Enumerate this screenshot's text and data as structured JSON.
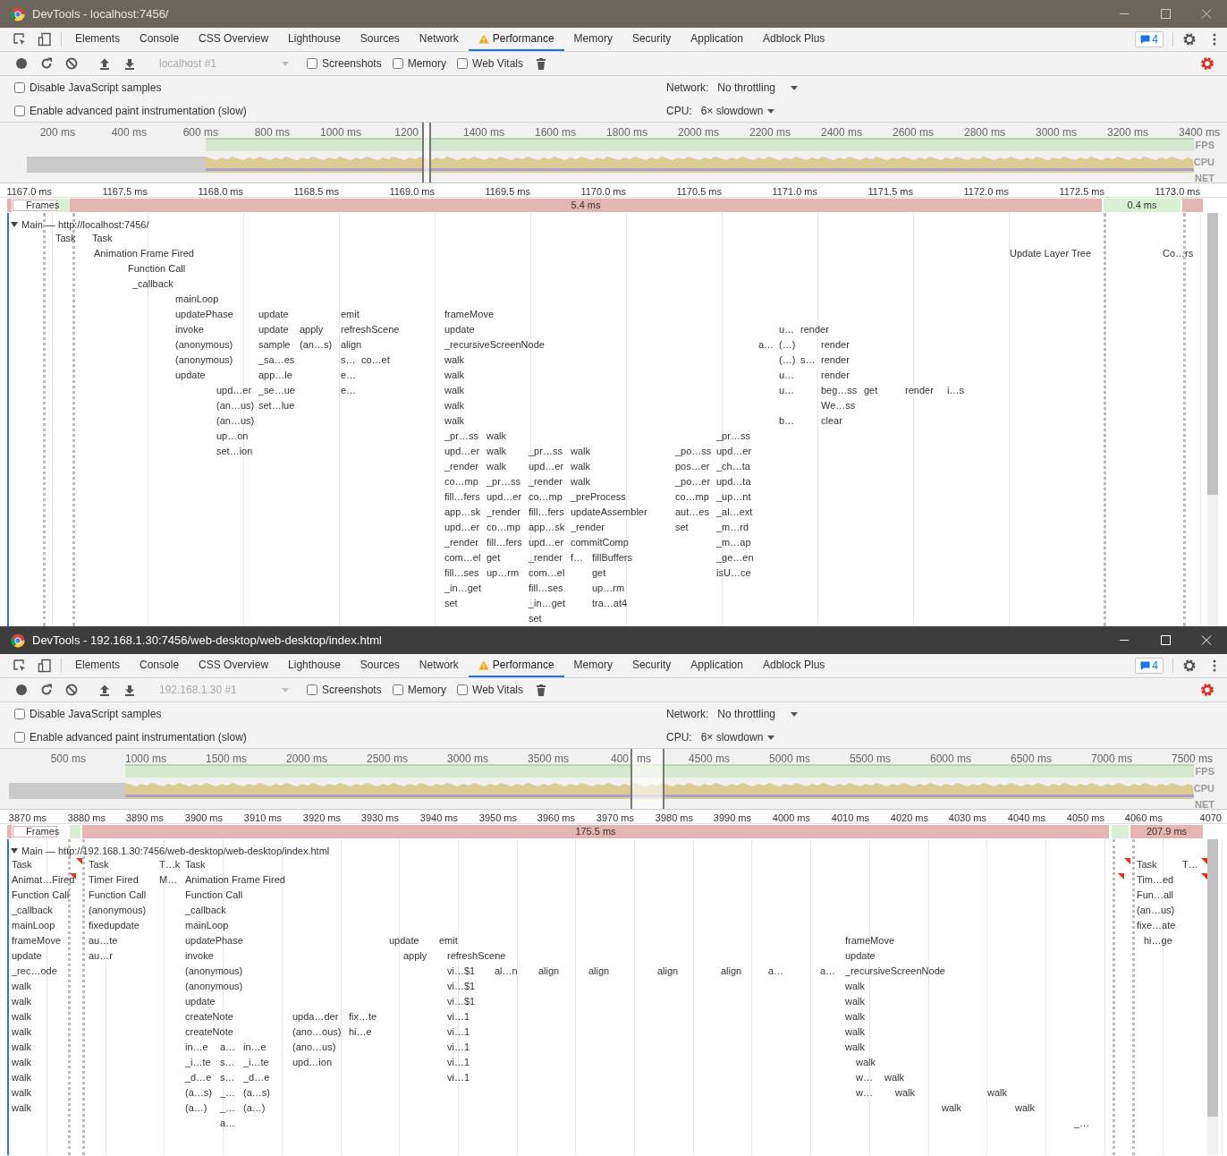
{
  "windows": [
    {
      "title": "DevTools - localhost:7456/",
      "active": false,
      "tabs": [
        {
          "label": "Elements",
          "selected": false,
          "warning": false
        },
        {
          "label": "Console",
          "selected": false,
          "warning": false
        },
        {
          "label": "CSS Overview",
          "selected": false,
          "warning": false
        },
        {
          "label": "Lighthouse",
          "selected": false,
          "warning": false
        },
        {
          "label": "Sources",
          "selected": false,
          "warning": false
        },
        {
          "label": "Network",
          "selected": false,
          "warning": false
        },
        {
          "label": "Performance",
          "selected": true,
          "warning": true
        },
        {
          "label": "Memory",
          "selected": false,
          "warning": false
        },
        {
          "label": "Security",
          "selected": false,
          "warning": false
        },
        {
          "label": "Application",
          "selected": false,
          "warning": false
        },
        {
          "label": "Adblock Plus",
          "selected": false,
          "warning": false
        }
      ],
      "messages_badge": "4",
      "toolbar": {
        "target": "localhost #1",
        "checkboxes": [
          {
            "label": "Screenshots",
            "checked": false
          },
          {
            "label": "Memory",
            "checked": false
          },
          {
            "label": "Web Vitals",
            "checked": false
          }
        ]
      },
      "settings": {
        "checkboxes": [
          {
            "label": "Disable JavaScript samples",
            "checked": false
          },
          {
            "label": "Enable advanced paint instrumentation (slow)",
            "checked": false
          }
        ],
        "network_label": "Network:",
        "network_value": "No throttling",
        "cpu_label": "CPU:",
        "cpu_value": "6× slowdown"
      },
      "overview": {
        "ticks": [
          "200 ms",
          "400 ms",
          "600 ms",
          "800 ms",
          "1000 ms",
          "1200",
          "1400 ms",
          "1600 ms",
          "1800 ms",
          "2000 ms",
          "2200 ms",
          "2400 ms",
          "2600 ms",
          "2800 ms",
          "3000 ms",
          "3200 ms",
          "3400 ms"
        ],
        "tracks": [
          "FPS",
          "CPU",
          "NET"
        ]
      },
      "ruler": {
        "ticks": [
          "1167.0 ms",
          "1167.5 ms",
          "1168.0 ms",
          "1168.5 ms",
          "1169.0 ms",
          "1169.5 ms",
          "1170.0 ms",
          "1170.5 ms",
          "1171.0 ms",
          "1171.5 ms",
          "1172.0 ms",
          "1172.5 ms",
          "1173.0 ms"
        ]
      },
      "frames": {
        "label": "Frames",
        "segments": [
          {
            "kind": "dropped"
          },
          {
            "kind": "idle"
          },
          {
            "kind": "dropped",
            "text": "5.4 ms"
          },
          {
            "kind": "idle",
            "text": "0.4 ms"
          },
          {
            "kind": "dropped"
          }
        ]
      },
      "main": {
        "label": "Main — http://localhost:7456/",
        "expanded": true
      },
      "flame": {
        "columns": [
          {
            "entries": [
              "Task"
            ]
          },
          {
            "entries": [
              "Task"
            ]
          },
          {
            "entries": [
              "Animation Frame Fired"
            ]
          },
          {
            "entries": [
              "Function Call"
            ]
          },
          {
            "entries": [
              "_callback"
            ]
          },
          {
            "entries": [
              "mainLoop",
              "updatePhase",
              "invoke",
              "(anonymous)",
              "(anonymous)",
              "update"
            ]
          },
          {
            "entries": [
              "upd…er",
              "(an…us)",
              "(an…us)",
              "up…on",
              "set…ion"
            ]
          },
          {
            "entries": [
              "update",
              "update",
              "sample",
              "_sa…es",
              "app…le",
              "_se…ue",
              "set…lue"
            ]
          },
          {
            "entries": [
              "apply",
              "(an…s)"
            ]
          },
          {
            "entries": [
              "emit",
              "refreshScene",
              "align",
              "s…",
              "e…",
              "e…"
            ]
          },
          {
            "entries": [
              "co…et"
            ]
          },
          {
            "entries": [
              "frameMove",
              "update",
              "_recursiveScreenNode",
              "walk",
              "walk",
              "walk",
              "walk",
              "walk",
              "_pr…ss",
              "upd…er",
              "_render",
              "co…mp",
              "fill…fers",
              "app…sk",
              "upd…er",
              "_render",
              "com…el",
              "fill…ses",
              "_in…get",
              "set"
            ]
          },
          {
            "entries": [
              "walk",
              "walk",
              "walk",
              "_pr…ss",
              "upd…er",
              "_render",
              "co…mp",
              "fill…fers",
              "get",
              "up…rm"
            ]
          },
          {
            "entries": [
              "_pr…ss",
              "upd…er",
              "_render",
              "co…mp",
              "fill…fers",
              "app…sk",
              "upd…er",
              "_render",
              "com…el",
              "fill…ses",
              "_in…get",
              "set"
            ]
          },
          {
            "entries": [
              "walk",
              "walk",
              "walk",
              "_preProcess",
              "updateAssembler",
              "_render",
              "commitComp"
            ]
          },
          {
            "entries": [
              "f…"
            ]
          },
          {
            "entries": [
              "fillBuffers",
              "get",
              "up…rm",
              "tra…at4"
            ]
          },
          {
            "entries": [
              "_po…ss",
              "pos…er",
              "_po…er",
              "co…mp",
              "aut…es",
              "set"
            ]
          },
          {
            "entries": [
              "_pr…ss",
              "upd…er",
              "_ch…ta",
              "upd…ta",
              "_up…nt",
              "_al…ext",
              "_m…rd",
              "_m…ap",
              "_ge…en",
              "isU…ce"
            ]
          },
          {
            "entries": [
              "a…"
            ]
          },
          {
            "entries": [
              "u…",
              "(…)",
              "(…)",
              "u…",
              "u…"
            ]
          },
          {
            "entries": [
              "b…"
            ]
          },
          {
            "entries": [
              "render"
            ]
          },
          {
            "entries": [
              "s…"
            ]
          },
          {
            "entries": [
              "render",
              "render",
              "render",
              "beg…ss",
              "We…ss",
              "clear"
            ]
          },
          {
            "entries": [
              "get"
            ]
          },
          {
            "entries": [
              "render"
            ]
          },
          {
            "entries": [
              "i…s"
            ]
          },
          {
            "entries": [
              "Update Layer Tree"
            ]
          },
          {
            "entries": [
              "Co…rs"
            ]
          }
        ]
      }
    },
    {
      "title": "DevTools - 192.168.1.30:7456/web-desktop/web-desktop/index.html",
      "active": true,
      "tabs": [
        {
          "label": "Elements",
          "selected": false,
          "warning": false
        },
        {
          "label": "Console",
          "selected": false,
          "warning": false
        },
        {
          "label": "CSS Overview",
          "selected": false,
          "warning": false
        },
        {
          "label": "Lighthouse",
          "selected": false,
          "warning": false
        },
        {
          "label": "Sources",
          "selected": false,
          "warning": false
        },
        {
          "label": "Network",
          "selected": false,
          "warning": false
        },
        {
          "label": "Performance",
          "selected": true,
          "warning": true
        },
        {
          "label": "Memory",
          "selected": false,
          "warning": false
        },
        {
          "label": "Security",
          "selected": false,
          "warning": false
        },
        {
          "label": "Application",
          "selected": false,
          "warning": false
        },
        {
          "label": "Adblock Plus",
          "selected": false,
          "warning": false
        }
      ],
      "messages_badge": "4",
      "toolbar": {
        "target": "192.168.1.30 #1",
        "checkboxes": [
          {
            "label": "Screenshots",
            "checked": false
          },
          {
            "label": "Memory",
            "checked": false
          },
          {
            "label": "Web Vitals",
            "checked": false
          }
        ]
      },
      "settings": {
        "checkboxes": [
          {
            "label": "Disable JavaScript samples",
            "checked": false
          },
          {
            "label": "Enable advanced paint instrumentation (slow)",
            "checked": false
          }
        ],
        "network_label": "Network:",
        "network_value": "No throttling",
        "cpu_label": "CPU:",
        "cpu_value": "6× slowdown"
      },
      "overview": {
        "ticks": [
          "500 ms",
          "1000 ms",
          "1500 ms",
          "2000 ms",
          "2500 ms",
          "3000 ms",
          "3500 ms",
          "400",
          "ms",
          "4500 ms",
          "5000 ms",
          "5500 ms",
          "6000 ms",
          "6500 ms",
          "7000 ms",
          "7500 ms"
        ],
        "tracks": [
          "FPS",
          "CPU",
          "NET"
        ]
      },
      "ruler": {
        "ticks": [
          "3870 ms",
          "3880 ms",
          "3890 ms",
          "3900 ms",
          "3910 ms",
          "3920 ms",
          "3930 ms",
          "3940 ms",
          "3950 ms",
          "3960 ms",
          "3970 ms",
          "3980 ms",
          "3990 ms",
          "4000 ms",
          "4010 ms",
          "4020 ms",
          "4030 ms",
          "4040 ms",
          "4050 ms",
          "4060 ms",
          "4070"
        ]
      },
      "frames": {
        "label": "Frames",
        "segments": [
          {
            "kind": "dropped"
          },
          {
            "kind": "idle"
          },
          {
            "kind": "dropped",
            "text": "175.5 ms"
          },
          {
            "kind": "idle"
          },
          {
            "kind": "dropped",
            "text": "207.9 ms"
          }
        ]
      },
      "main": {
        "label": "Main — http://192.168.1.30:7456/web-desktop/web-desktop/index.html",
        "expanded": true
      },
      "flame": {
        "columns": [
          {
            "entries": [
              "Task",
              "Animat…Fired",
              "Function Call",
              "_callback",
              "mainLoop",
              "frameMove",
              "update",
              "_rec…ode",
              "walk",
              "walk",
              "walk",
              "walk",
              "walk",
              "walk",
              "walk",
              "walk",
              "walk"
            ],
            "flagged": true
          },
          {
            "entries": [
              "Task",
              "Timer Fired",
              "Function Call",
              "(anonymous)",
              "fixedupdate",
              "au…te",
              "au…r"
            ]
          },
          {
            "entries": [
              "T…k",
              "M…"
            ]
          },
          {
            "entries": [
              "Task",
              "Animation Frame Fired",
              "Function Call",
              "_callback",
              "mainLoop",
              "updatePhase",
              "invoke",
              "(anonymous)",
              "(anonymous)",
              "update",
              "createNote",
              "createNote",
              "in…e",
              "_i…te",
              "_d…e",
              "(a…s)",
              "(a…)"
            ]
          },
          {
            "entries": [
              "a…",
              "s…",
              "s…",
              "_…",
              "_…",
              "a…"
            ]
          },
          {
            "entries": [
              "in…e",
              "_i…te",
              "_d…e",
              "(a…s)",
              "(a…)"
            ]
          },
          {
            "entries": [
              "upda…der",
              "(ano…ous)",
              "(ano…us)",
              "upd…ion"
            ]
          },
          {
            "entries": [
              "fix…te",
              "hi…e"
            ]
          },
          {
            "entries": [
              "update"
            ]
          },
          {
            "entries": [
              "apply"
            ]
          },
          {
            "entries": [
              "emit"
            ]
          },
          {
            "entries": [
              "refreshScene",
              "vi…$1",
              "vi…$1",
              "vi…$1",
              "vi…1",
              "vi…1",
              "vi…1",
              "vi…1",
              "vi…1"
            ]
          },
          {
            "entries": [
              "al…n"
            ]
          },
          {
            "entries": [
              "align"
            ]
          },
          {
            "entries": [
              "align"
            ]
          },
          {
            "entries": [
              "align"
            ]
          },
          {
            "entries": [
              "align"
            ]
          },
          {
            "entries": [
              "a…"
            ]
          },
          {
            "entries": [
              "a…"
            ]
          },
          {
            "entries": [
              "frameMove",
              "update",
              "_recursiveScreenNode",
              "walk",
              "walk",
              "walk",
              "walk",
              "walk"
            ]
          },
          {
            "entries": [
              "walk",
              "w…",
              "w…"
            ]
          },
          {
            "entries": [
              "walk"
            ]
          },
          {
            "entries": [
              "walk"
            ]
          },
          {
            "entries": [
              "walk"
            ]
          },
          {
            "entries": [
              "walk"
            ]
          },
          {
            "entries": [
              "walk"
            ]
          },
          {
            "entries": [
              "_…"
            ]
          },
          {
            "entries": [
              "Task",
              "Tim…ed",
              "Fun…all",
              "(an…us)",
              "fixe…ate"
            ],
            "flagged": true
          },
          {
            "entries": [
              "hi…ge"
            ]
          },
          {
            "entries": [
              "T…"
            ],
            "flagged": true
          }
        ]
      }
    }
  ]
}
